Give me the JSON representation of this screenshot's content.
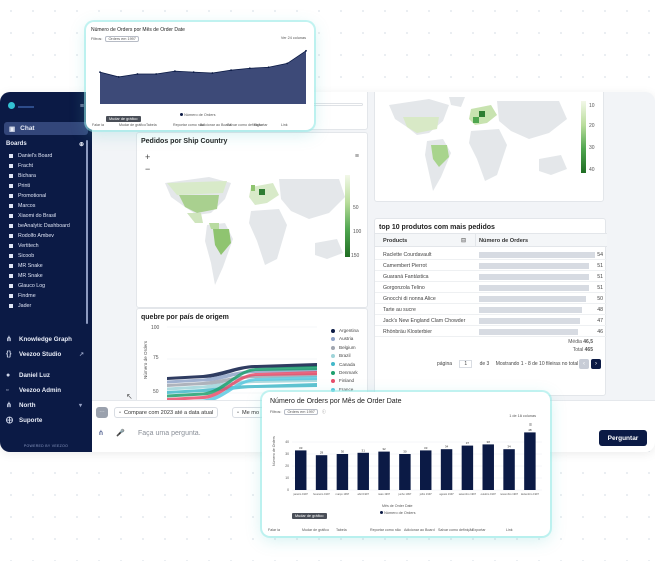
{
  "sidebar": {
    "chat_label": "Chat",
    "boards_label": "Boards",
    "boards": [
      "Daniel's Board",
      "Fracht",
      "Bichara",
      "Printi",
      "Promotional",
      "Marcos",
      "Xiaomi do Brasil",
      "beAnalytic Dashboard",
      "Rodolfo Ambev",
      "Vertitech",
      "Sicoob",
      "MR Snake",
      "MR Snake",
      "Glauco Log",
      "Findme",
      "Jader"
    ],
    "nav": [
      {
        "label": "Knowledge Graph",
        "icon": "graph-icon"
      },
      {
        "label": "Veezoo Studio",
        "icon": "code-icon"
      },
      {
        "label": "Daniel Luz",
        "icon": "user-icon"
      },
      {
        "label": "Veezoo Admin",
        "icon": "admin-icon"
      },
      {
        "label": "North",
        "icon": "graph-icon"
      },
      {
        "label": "Suporte",
        "icon": "help-icon"
      }
    ],
    "powered_by": "POWERED BY VEEZOO"
  },
  "map_card": {
    "title": "Pedidos por Ship Country",
    "legend_ticks": [
      "50",
      "100",
      "150"
    ]
  },
  "top_map_legend_ticks": [
    "10",
    "20",
    "30",
    "40"
  ],
  "top_products": {
    "title": "top 10 produtos com mais pedidos",
    "col_product": "Products",
    "col_orders": "Número de Orders",
    "rows": [
      {
        "name": "Raclette Courdavault",
        "value": 54
      },
      {
        "name": "Camembert Pierrot",
        "value": 51
      },
      {
        "name": "Guaraná Fantástica",
        "value": 51
      },
      {
        "name": "Gorgonzola Telino",
        "value": 51
      },
      {
        "name": "Gnocchi di nonna Alice",
        "value": 50
      },
      {
        "name": "Tarte au sucre",
        "value": 48
      },
      {
        "name": "Jack's New England Clam Chowder",
        "value": 47
      },
      {
        "name": "Rhönbräu Klosterbier",
        "value": 46
      }
    ],
    "media_label": "Média",
    "media_value": "46,5",
    "total_label": "Total",
    "total_value": "465",
    "pager": {
      "page_label": "página",
      "page": "1",
      "of": "de 3",
      "showing": "Mostrando 1 - 8 de 10 fileiras no total"
    }
  },
  "ribbon_card": {
    "title": "quebre por país de origem",
    "y_ticks": [
      "100",
      "75",
      "50"
    ],
    "y_label": "Número de Orders",
    "legend": [
      {
        "name": "Argentina",
        "color": "#0b1a45"
      },
      {
        "name": "Austria",
        "color": "#8fa3c8"
      },
      {
        "name": "Belgium",
        "color": "#a0a6b0"
      },
      {
        "name": "Brazil",
        "color": "#9fd4d9"
      },
      {
        "name": "Canada",
        "color": "#43b8c9"
      },
      {
        "name": "Denmark",
        "color": "#1fa06e"
      },
      {
        "name": "Finland",
        "color": "#e94e6b"
      },
      {
        "name": "France",
        "color": "#5cc9e0"
      }
    ]
  },
  "input_bar": {
    "chip_compare": "Compare com 2023 até a data atual",
    "chip_more": "Me mo",
    "placeholder": "Faça uma pergunta.",
    "button": "Perguntar"
  },
  "popup_small": {
    "title": "Número de Orders por Mês de Order Date",
    "filter_label": "Filtros:",
    "filter_tag": "Orders em 1997",
    "right_note": "Ver 24 colunas",
    "tooltip": "Mudar de gráfico",
    "legend": "Número de Orders",
    "toolbar": [
      "Falar ia",
      "Mudar de gráfico",
      "Tabela",
      "Reportar como não",
      "Adicionar ao Board",
      "Salvar como definição",
      "Exportar",
      "Link"
    ],
    "chart_data": {
      "type": "area",
      "series": [
        {
          "values": [
            33,
            28,
            31,
            31,
            34,
            33,
            32,
            35,
            37,
            38,
            42,
            55
          ]
        }
      ]
    }
  },
  "popup_large": {
    "title": "Número de Orders por Mês de Order Date",
    "filter_label": "Filtros:",
    "filter_tag": "Orders em 1997",
    "right_note": "1 de 1ã colunas",
    "tooltip": "Mudar de gráfico",
    "x_label": "Mês de Order Date",
    "y_label": "Número de Orders",
    "legend": "Número de Orders",
    "toolbar": [
      "Falar ia",
      "Mudar de gráfico",
      "Tabela",
      "Reportar como não",
      "Adicionar ao Board",
      "Salvar como definição",
      "Exportar",
      "Link"
    ],
    "chart_data": {
      "type": "bar",
      "categories": [
        "janeiro 1997",
        "fevereiro 1997",
        "março 1997",
        "abril 1997",
        "maio 1997",
        "junho 1997",
        "julho 1997",
        "agosto 1997",
        "setembro 1997",
        "outubro 1997",
        "novembro 1997",
        "dezembro 1997"
      ],
      "values": [
        33,
        29,
        30,
        31,
        32,
        30,
        33,
        34,
        37,
        38,
        34,
        48
      ],
      "y_ticks": [
        "40",
        "30",
        "20",
        "10",
        "0"
      ],
      "ylim": [
        0,
        50
      ]
    }
  },
  "colors": {
    "navy": "#0b1a45",
    "popup_glow": "#96ebe8",
    "area": "#3d4a78"
  }
}
